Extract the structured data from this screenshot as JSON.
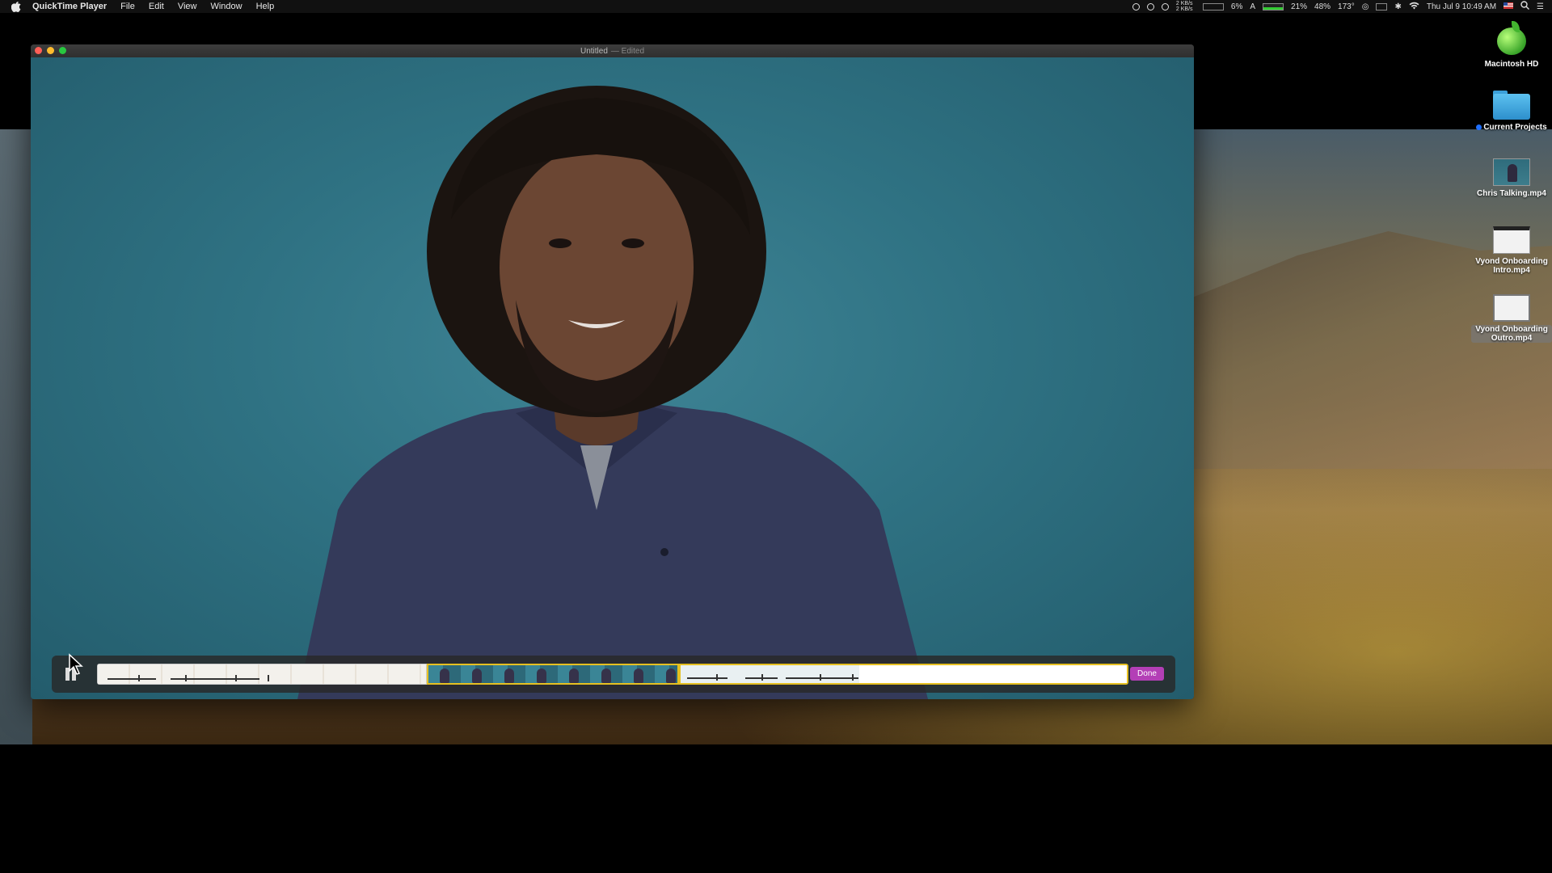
{
  "menubar": {
    "app_name": "QuickTime Player",
    "items": [
      "File",
      "Edit",
      "View",
      "Window",
      "Help"
    ],
    "status": {
      "net_up": "2 KB/s",
      "net_down": "2 KB/s",
      "cpu": "6%",
      "letter": "A",
      "memory": "21%",
      "battery": "48%",
      "temperature": "173°",
      "datetime": "Thu Jul 9  10:49 AM"
    }
  },
  "window": {
    "title": "Untitled",
    "title_suffix": "— Edited"
  },
  "trim": {
    "done_label": "Done"
  },
  "desktop": {
    "icons": [
      {
        "label": "Macintosh HD"
      },
      {
        "label": "Current Projects"
      },
      {
        "label": "Chris Talking.mp4"
      },
      {
        "label": "Vyond Onboarding Intro.mp4"
      },
      {
        "label": "Vyond Onboarding Outro.mp4"
      }
    ]
  },
  "colors": {
    "accent_done": "#b33fb6",
    "trim_selection": "#e6c021",
    "video_background": "#2f7283"
  }
}
